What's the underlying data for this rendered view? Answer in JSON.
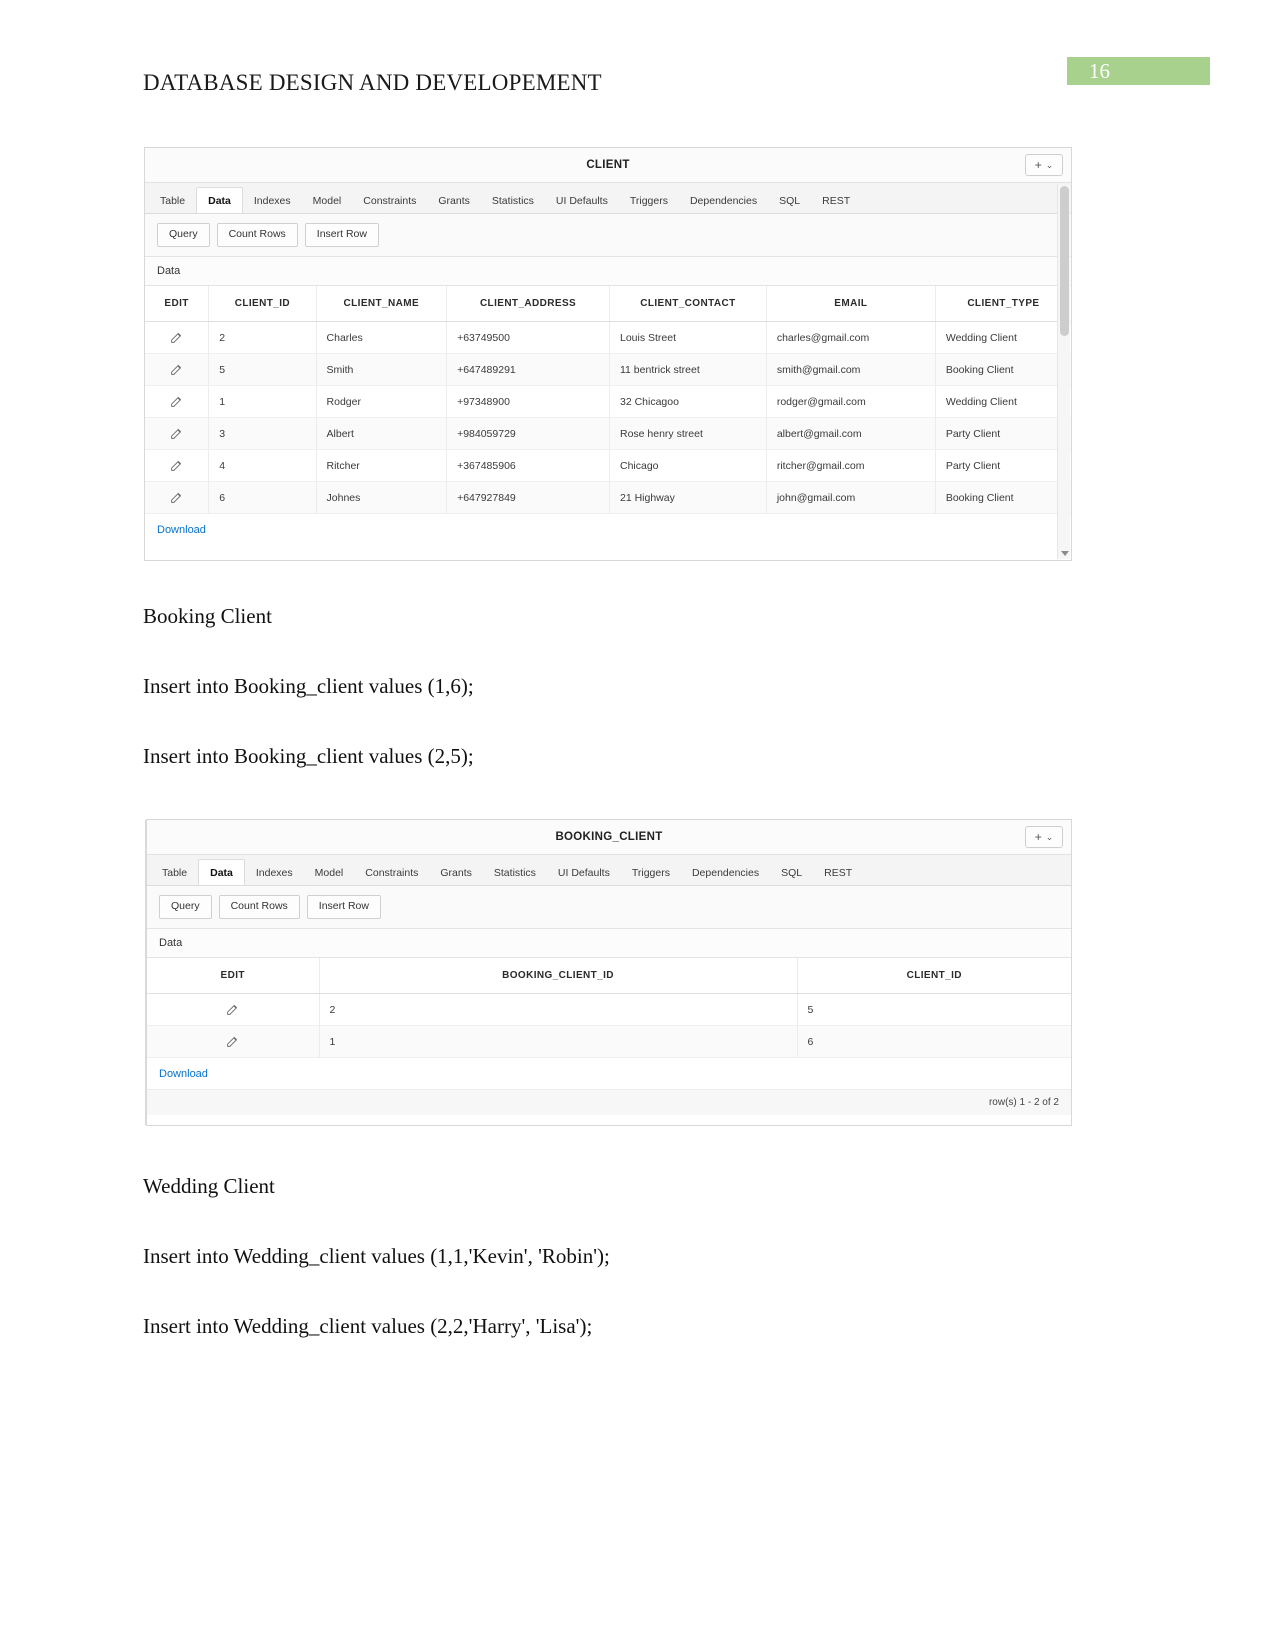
{
  "document": {
    "header_title": "DATABASE DESIGN AND DEVELOPEMENT",
    "page_number": "16",
    "page_badge_color": "#a9d18e"
  },
  "tabs": [
    "Table",
    "Data",
    "Indexes",
    "Model",
    "Constraints",
    "Grants",
    "Statistics",
    "UI Defaults",
    "Triggers",
    "Dependencies",
    "SQL",
    "REST"
  ],
  "active_tab": "Data",
  "action_buttons": [
    "Query",
    "Count Rows",
    "Insert Row"
  ],
  "region_label": "Data",
  "download_label": "Download",
  "title_actions": {
    "plus": "+",
    "chevron": "⌄"
  },
  "client_widget": {
    "title": "CLIENT",
    "columns": [
      "EDIT",
      "CLIENT_ID",
      "CLIENT_NAME",
      "CLIENT_ADDRESS",
      "CLIENT_CONTACT",
      "EMAIL",
      "CLIENT_TYPE"
    ],
    "rows": [
      {
        "client_id": "2",
        "client_name": "Charles",
        "client_address": "+63749500",
        "client_contact": "Louis Street",
        "email": "charles@gmail.com",
        "client_type": "Wedding Client"
      },
      {
        "client_id": "5",
        "client_name": "Smith",
        "client_address": "+647489291",
        "client_contact": "11 bentrick street",
        "email": "smith@gmail.com",
        "client_type": "Booking Client"
      },
      {
        "client_id": "1",
        "client_name": "Rodger",
        "client_address": "+97348900",
        "client_contact": "32 Chicagoo",
        "email": "rodger@gmail.com",
        "client_type": "Wedding Client"
      },
      {
        "client_id": "3",
        "client_name": "Albert",
        "client_address": "+984059729",
        "client_contact": "Rose henry street",
        "email": "albert@gmail.com",
        "client_type": "Party Client"
      },
      {
        "client_id": "4",
        "client_name": "Ritcher",
        "client_address": "+367485906",
        "client_contact": "Chicago",
        "email": "ritcher@gmail.com",
        "client_type": "Party Client"
      },
      {
        "client_id": "6",
        "client_name": "Johnes",
        "client_address": "+647927849",
        "client_contact": "21 Highway",
        "email": "john@gmail.com",
        "client_type": "Booking Client"
      }
    ]
  },
  "booking_widget": {
    "title": "BOOKING_CLIENT",
    "columns": [
      "EDIT",
      "BOOKING_CLIENT_ID",
      "CLIENT_ID"
    ],
    "rows": [
      {
        "booking_client_id": "2",
        "client_id": "5"
      },
      {
        "booking_client_id": "1",
        "client_id": "6"
      }
    ],
    "row_count_text": "row(s) 1 - 2 of 2"
  },
  "body_text": {
    "booking_heading": "Booking Client",
    "booking_insert_1": "Insert into Booking_client values (1,6);",
    "booking_insert_2": "Insert into Booking_client values (2,5);",
    "wedding_heading": "Wedding Client",
    "wedding_insert_1": "Insert into Wedding_client values (1,1,'Kevin', 'Robin');",
    "wedding_insert_2": "Insert into Wedding_client values (2,2,'Harry', 'Lisa');"
  }
}
